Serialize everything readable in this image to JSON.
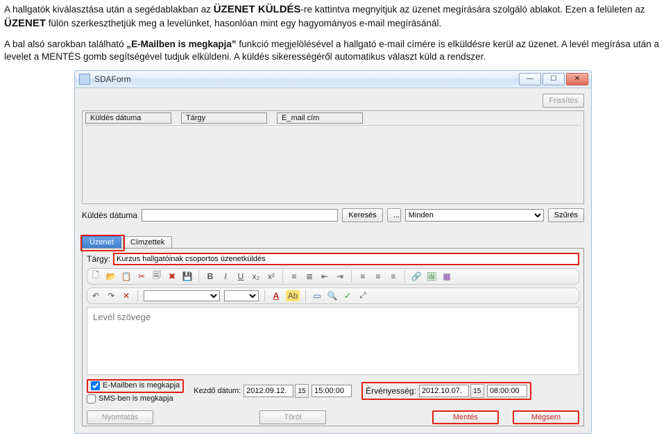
{
  "doc": {
    "p1_a": "A hallgatók kiválasztása után a segédablakban az ",
    "p1_b": "ÜZENET KÜLDÉS",
    "p1_c": "-re kattintva megnyitjuk az üzenet megírására szolgáló ablakot. Ezen a felületen az ",
    "p1_d": "ÜZENET",
    "p1_e": " fülön szerkeszthetjük meg a levelünket, hasonlóan mint egy hagyományos e-mail megírásánál.",
    "p2_a": "A bal alsó sarokban található ",
    "p2_b": "„E-Mailben is megkapja”",
    "p2_c": " funkció megjelölésével a hallgató e-mail címére is elküldésre kerül az üzenet. A levél megírása után a levelet a MENTÉS gomb segítségével tudjuk elküldeni. A küldés sikerességéről automatikus választ küld a rendszer."
  },
  "window": {
    "title": "SDAForm",
    "min": "—",
    "max": "☐",
    "close": "✕"
  },
  "top": {
    "refresh": "Frissítés",
    "headers": {
      "date": "Küldés dátuma",
      "subject": "Tárgy",
      "email": "E_mail cím"
    },
    "search_label": "Küldés dátuma",
    "search_btn": "Keresés",
    "dots": "...",
    "all_option": "Minden",
    "filter_btn": "Szűrés"
  },
  "msg": {
    "tabs": {
      "active": "Üzenet",
      "other": "Címzettek"
    },
    "subject_label": "Tárgy:",
    "subject_value": "Kurzus hallgatóinak csoportos üzenetküldés",
    "editor_placeholder": "Levél szövege",
    "email_chk": "E-Mailben is megkapja",
    "sms_chk": "SMS-ben is megkapja",
    "start_label": "Kezdő dátum:",
    "start_date": "2012.09.12.",
    "start_time": "15:00:00",
    "valid_label": "Érvényesség:",
    "valid_date": "2012.10.07.",
    "valid_time": "08:00:00",
    "print": "Nyomtatás",
    "delete": "Töröl",
    "save": "Mentés",
    "cancel": "Mégsem"
  },
  "icons": {
    "new": "🗋",
    "open": "📂",
    "paste": "📋",
    "cut": "✂",
    "copy": "🗐",
    "delete": "✖",
    "save": "💾",
    "bold": "B",
    "italic": "I",
    "uline": "U",
    "sub": "x₂",
    "sup": "x²",
    "ol": "≡",
    "ul": "≣",
    "indent": "⇥",
    "outdent": "⇤",
    "left": "≡",
    "center": "≡",
    "right": "≡",
    "link": "🔗",
    "image": "🖼",
    "table": "▦",
    "undo": "↶",
    "redo": "↷",
    "clear": "✕",
    "color": "A",
    "hilite": "Ab",
    "object": "▭",
    "find": "🔍",
    "spell": "✓",
    "zoom": "⤢",
    "cal": "15"
  }
}
